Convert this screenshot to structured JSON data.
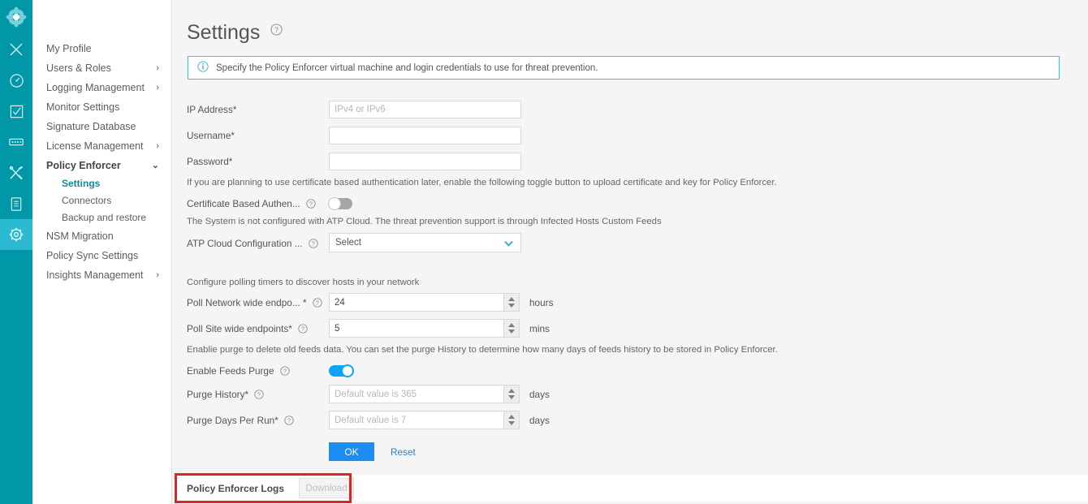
{
  "colors": {
    "rail_bg": "#0097a7",
    "rail_active": "#2ab9d0",
    "accent_teal": "#0f8a9c",
    "accent_blue": "#1a8cf2",
    "info_border": "#33c3f0",
    "highlight_red": "#e32222",
    "toggle_on": "#0aa5f5",
    "toggle_off": "#a6a6a6",
    "page_bg": "#f5f5f5"
  },
  "rail": {
    "items": [
      {
        "icon": "juniper-logo-icon",
        "label": "Logo",
        "active": false
      },
      {
        "icon": "close-x-icon",
        "label": "Close",
        "active": false
      },
      {
        "icon": "dashboard-gauge-icon",
        "label": "Dashboard",
        "active": false
      },
      {
        "icon": "monitor-checkbox-icon",
        "label": "Monitor",
        "active": false
      },
      {
        "icon": "devices-icon",
        "label": "Devices",
        "active": false
      },
      {
        "icon": "tools-icon",
        "label": "Configure",
        "active": false
      },
      {
        "icon": "reports-document-icon",
        "label": "Reports",
        "active": false
      },
      {
        "icon": "gear-icon",
        "label": "Administration",
        "active": true
      }
    ]
  },
  "sidebar": {
    "items": [
      {
        "label": "My Profile",
        "expandable": false,
        "bold": false
      },
      {
        "label": "Users & Roles",
        "expandable": true,
        "chevron": "›",
        "bold": false
      },
      {
        "label": "Logging Management",
        "expandable": true,
        "chevron": "›",
        "bold": false
      },
      {
        "label": "Monitor Settings",
        "expandable": false,
        "bold": false
      },
      {
        "label": "Signature Database",
        "expandable": false,
        "bold": false
      },
      {
        "label": "License Management",
        "expandable": true,
        "chevron": "›",
        "bold": false
      },
      {
        "label": "Policy Enforcer",
        "expandable": true,
        "chevron": "⌄",
        "bold": true
      }
    ],
    "subitems": [
      {
        "label": "Settings",
        "active": true
      },
      {
        "label": "Connectors",
        "active": false
      },
      {
        "label": "Backup and restore",
        "active": false
      }
    ],
    "items_after": [
      {
        "label": "NSM Migration",
        "expandable": false,
        "bold": false
      },
      {
        "label": "Policy Sync Settings",
        "expandable": false,
        "bold": false
      },
      {
        "label": "Insights Management",
        "expandable": true,
        "chevron": "›",
        "bold": false
      }
    ]
  },
  "header": {
    "title": "Settings",
    "help_icon": "help-circle-icon"
  },
  "info_banner": {
    "icon": "info-circle-icon",
    "text": "Specify the Policy Enforcer virtual machine and login credentials to use for threat prevention."
  },
  "form": {
    "ip_address": {
      "label": "IP Address*",
      "value": "",
      "placeholder": "IPv4 or IPv6"
    },
    "username": {
      "label": "Username*",
      "value": "",
      "placeholder": ""
    },
    "password": {
      "label": "Password*",
      "value": "",
      "placeholder": ""
    },
    "cert_help": "If you are planning to use certificate based authentication later, enable the following toggle button to upload certificate and key for Policy Enforcer.",
    "cert_auth": {
      "label": "Certificate Based Authen...",
      "state": "off",
      "help_icon": "help-circle-icon"
    },
    "atp_note": "The System is not configured with ATP Cloud. The threat prevention support is through Infected Hosts Custom Feeds",
    "atp_cloud": {
      "label": "ATP Cloud Configuration ...",
      "selected": "Select",
      "help_icon": "help-circle-icon",
      "chevron": "chevron-down-icon"
    },
    "polling_note": "Configure polling timers to discover hosts in your network",
    "poll_network": {
      "label": "Poll Network wide endpo... *",
      "value": "24",
      "unit": "hours",
      "help_icon": "help-circle-icon"
    },
    "poll_site": {
      "label": "Poll Site wide endpoints*",
      "value": "5",
      "unit": "mins",
      "help_icon": "help-circle-icon"
    },
    "purge_note": "Enablie purge to delete old feeds data. You can set the purge History to determine how many days of feeds history to be stored in Policy Enforcer.",
    "enable_purge": {
      "label": "Enable Feeds Purge",
      "state": "on",
      "help_icon": "help-circle-icon"
    },
    "purge_history": {
      "label": "Purge History*",
      "value": "",
      "placeholder": "Default value is 365",
      "unit": "days",
      "help_icon": "help-circle-icon"
    },
    "purge_days_run": {
      "label": "Purge Days Per Run*",
      "value": "",
      "placeholder": "Default value is 7",
      "unit": "days",
      "help_icon": "help-circle-icon"
    },
    "ok_label": "OK",
    "reset_label": "Reset"
  },
  "logs": {
    "label": "Policy Enforcer Logs",
    "download_label": "Download",
    "download_enabled": false
  }
}
